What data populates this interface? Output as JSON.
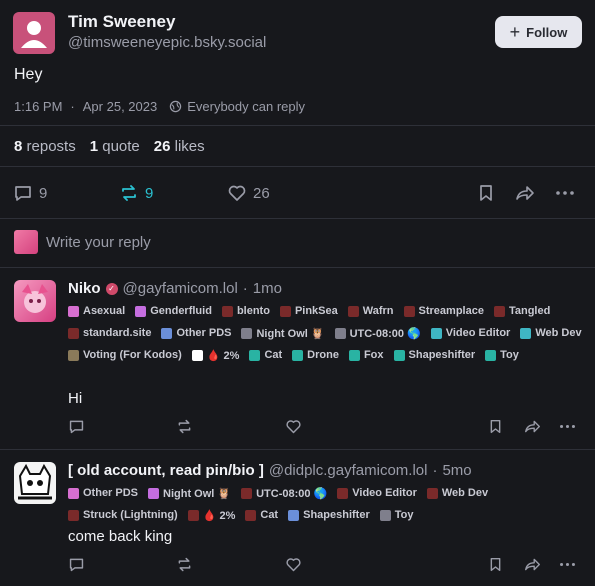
{
  "post": {
    "author_name": "Tim Sweeney",
    "author_handle": "@timsweeneyepic.bsky.social",
    "follow_label": "Follow",
    "text": "Hey",
    "time": "1:16 PM",
    "date": "Apr 25, 2023",
    "separator": "·",
    "reply_setting": "Everybody can reply",
    "stats": {
      "reposts_count": "8",
      "reposts_label": "reposts",
      "quotes_count": "1",
      "quotes_label": "quote",
      "likes_count": "26",
      "likes_label": "likes"
    },
    "actions": {
      "replies": "9",
      "reposts": "9",
      "likes": "26"
    }
  },
  "reply_box": {
    "placeholder": "Write your reply"
  },
  "replies": [
    {
      "name": "Niko",
      "handle": "@gayfamicom.lol",
      "age": "1mo",
      "text": "Hi",
      "labels": [
        "Asexual",
        "Genderfluid",
        "blento",
        "PinkSea",
        "Wafrn",
        "Streamplace",
        "Tangled",
        "standard.site",
        "Other PDS",
        "Night Owl 🦉",
        "UTC-08:00 🌎",
        "Video Editor",
        "Web Dev",
        "Voting (For Kodos)",
        "🩸 2%",
        "Cat",
        "Drone",
        "Fox",
        "Shapeshifter",
        "Toy"
      ]
    },
    {
      "name": "[ old account, read pin/bio ]",
      "handle": "@didplc.gayfamicom.lol",
      "age": "5mo",
      "text": "come back king",
      "labels": [
        "Other PDS",
        "Night Owl 🦉",
        "UTC-08:00 🌎",
        "Video Editor",
        "Web Dev",
        "Struck (Lightning)",
        "🩸 2%",
        "Cat",
        "Shapeshifter",
        "Toy"
      ]
    }
  ],
  "colors": {
    "background": "#17181c",
    "accent_teal": "#2bc1d1",
    "muted": "#9a9ca8",
    "divider": "#2e3038"
  }
}
